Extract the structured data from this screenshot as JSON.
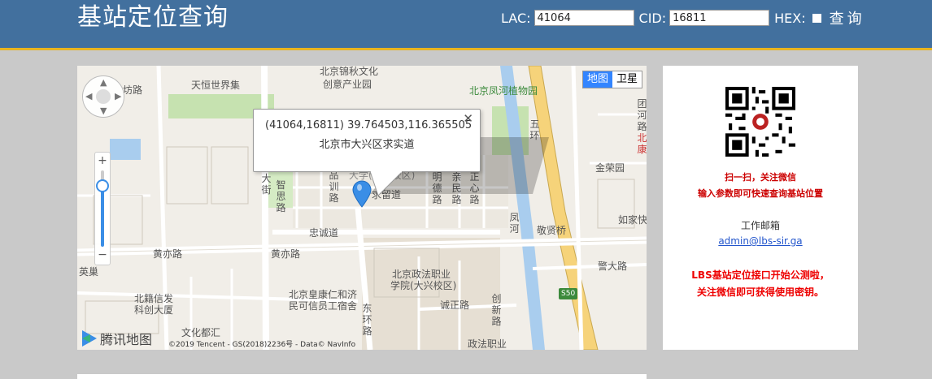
{
  "header": {
    "title": "基站定位查询",
    "lac_label": "LAC:",
    "lac_value": "41064",
    "cid_label": "CID:",
    "cid_value": "16811",
    "hex_label": "HEX:",
    "query_button": "查询"
  },
  "map": {
    "type_tabs": [
      "地图",
      "卫星"
    ],
    "info": {
      "coords": "(41064,16811) 39.764503,116.365505",
      "address": "北京市大兴区求实道"
    },
    "labels": {
      "l1": "坊路",
      "l2": "天恒世界集",
      "l3": "北京锦秋文化",
      "l4": "创意产业园",
      "l5": "北京凤河植物园",
      "l6": "金荣园",
      "l7": "如家快",
      "l8": "敬贤桥",
      "l9": "警大路",
      "l10": "黄亦路",
      "l11": "忠诚道",
      "l12": "黄亦路",
      "l13": "北京政法职业",
      "l14": "学院(大兴校区)",
      "l15": "北京皇康仁和济",
      "l16": "民可信员工宿舍",
      "l17": "诚正路",
      "l18": "北籍信发",
      "l19": "科创大厦",
      "l20": "文化都汇",
      "l21": "政法职业",
      "l22": "英巢",
      "l23": "S50",
      "v1": "大街",
      "v2": "智思路",
      "v3": "品训路",
      "v4": "明德路",
      "v5": "亲民路",
      "v6": "正心路",
      "v7": "五环",
      "v8": "凤河",
      "v9": "团河路",
      "v10": "北康",
      "v11": "东环路",
      "v12": "创新路",
      "v13": "求留道",
      "v14": "大学(大兴校区)"
    },
    "logo_text": "腾讯地图",
    "copyright": "©2019 Tencent - GS(2018)2236号 - Data© NavInfo"
  },
  "panel": {
    "scan_line1": "扫一扫，关注微信",
    "scan_line2": "输入参数即可快速查询基站位置",
    "email_label": "工作邮箱",
    "email": "admin@lbs-sir.ga",
    "notice_line1": "LBS基站定位接口开始公测啦，",
    "notice_line2": "关注微信即可获得使用密钥。"
  },
  "colors": {
    "header_bg": "#42709e",
    "header_border": "#e8b420",
    "notice_red": "#e00000"
  }
}
